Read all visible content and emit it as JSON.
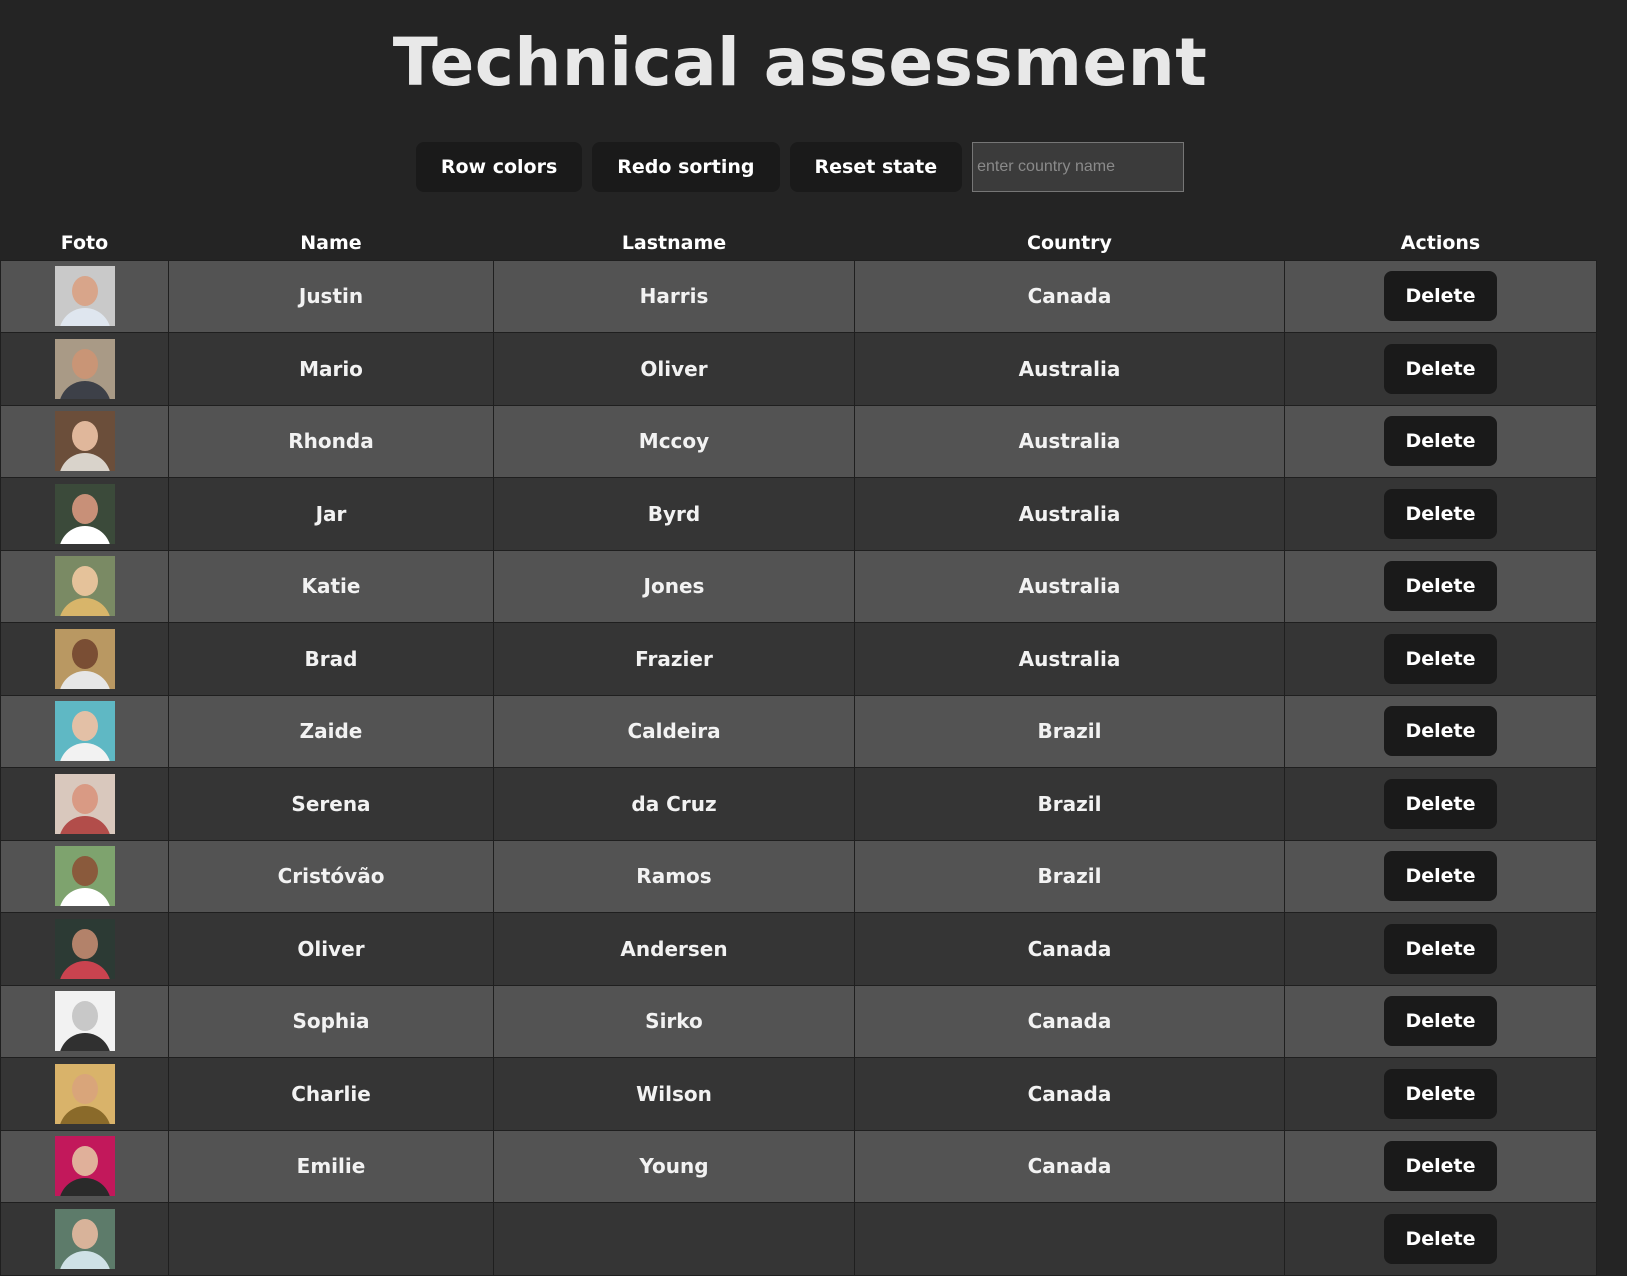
{
  "page": {
    "title": "Technical assessment"
  },
  "toolbar": {
    "row_colors_label": "Row colors",
    "redo_sorting_label": "Redo sorting",
    "reset_state_label": "Reset state",
    "country_filter_placeholder": "enter country name",
    "country_filter_value": ""
  },
  "table": {
    "headers": [
      "Foto",
      "Name",
      "Lastname",
      "Country",
      "Actions"
    ],
    "delete_label": "Delete",
    "rows": [
      {
        "name": "Justin",
        "lastname": "Harris",
        "country": "Canada",
        "photo": {
          "bg": "#c9c9c9",
          "skin": "#d8a58a",
          "shirt": "#dfe6ef"
        }
      },
      {
        "name": "Mario",
        "lastname": "Oliver",
        "country": "Australia",
        "photo": {
          "bg": "#a99a86",
          "skin": "#c99576",
          "shirt": "#3d4048"
        }
      },
      {
        "name": "Rhonda",
        "lastname": "Mccoy",
        "country": "Australia",
        "photo": {
          "bg": "#6b4e3a",
          "skin": "#e0b79b",
          "shirt": "#d9d3cb"
        }
      },
      {
        "name": "Jar",
        "lastname": "Byrd",
        "country": "Australia",
        "photo": {
          "bg": "#3b4a3a",
          "skin": "#c89078",
          "shirt": "#ffffff"
        }
      },
      {
        "name": "Katie",
        "lastname": "Jones",
        "country": "Australia",
        "photo": {
          "bg": "#7a8a64",
          "skin": "#e5c29a",
          "shirt": "#d8b56a"
        }
      },
      {
        "name": "Brad",
        "lastname": "Frazier",
        "country": "Australia",
        "photo": {
          "bg": "#b99862",
          "skin": "#7a4e34",
          "shirt": "#e6e6e6"
        }
      },
      {
        "name": "Zaide",
        "lastname": "Caldeira",
        "country": "Brazil",
        "photo": {
          "bg": "#5fb8c4",
          "skin": "#e3c0a6",
          "shirt": "#f2f2f2"
        }
      },
      {
        "name": "Serena",
        "lastname": "da Cruz",
        "country": "Brazil",
        "photo": {
          "bg": "#d9c8bd",
          "skin": "#d99a84",
          "shirt": "#b24d4a"
        }
      },
      {
        "name": "Cristóvão",
        "lastname": "Ramos",
        "country": "Brazil",
        "photo": {
          "bg": "#7ea36e",
          "skin": "#8a5a3c",
          "shirt": "#ffffff"
        }
      },
      {
        "name": "Oliver",
        "lastname": "Andersen",
        "country": "Canada",
        "photo": {
          "bg": "#2c3a34",
          "skin": "#b3826a",
          "shirt": "#c9434f"
        }
      },
      {
        "name": "Sophia",
        "lastname": "Sirko",
        "country": "Canada",
        "photo": {
          "bg": "#f2f2f2",
          "skin": "#c8c8c8",
          "shirt": "#303030"
        }
      },
      {
        "name": "Charlie",
        "lastname": "Wilson",
        "country": "Canada",
        "photo": {
          "bg": "#d9b36a",
          "skin": "#d9a57a",
          "shirt": "#8a6a2a"
        }
      },
      {
        "name": "Emilie",
        "lastname": "Young",
        "country": "Canada",
        "photo": {
          "bg": "#c2185b",
          "skin": "#e0b09a",
          "shirt": "#2a2a2a"
        }
      },
      {
        "name": "",
        "lastname": "",
        "country": "",
        "photo": {
          "bg": "#5d7b6a",
          "skin": "#d8b39a",
          "shirt": "#cfe1e6"
        }
      }
    ]
  }
}
